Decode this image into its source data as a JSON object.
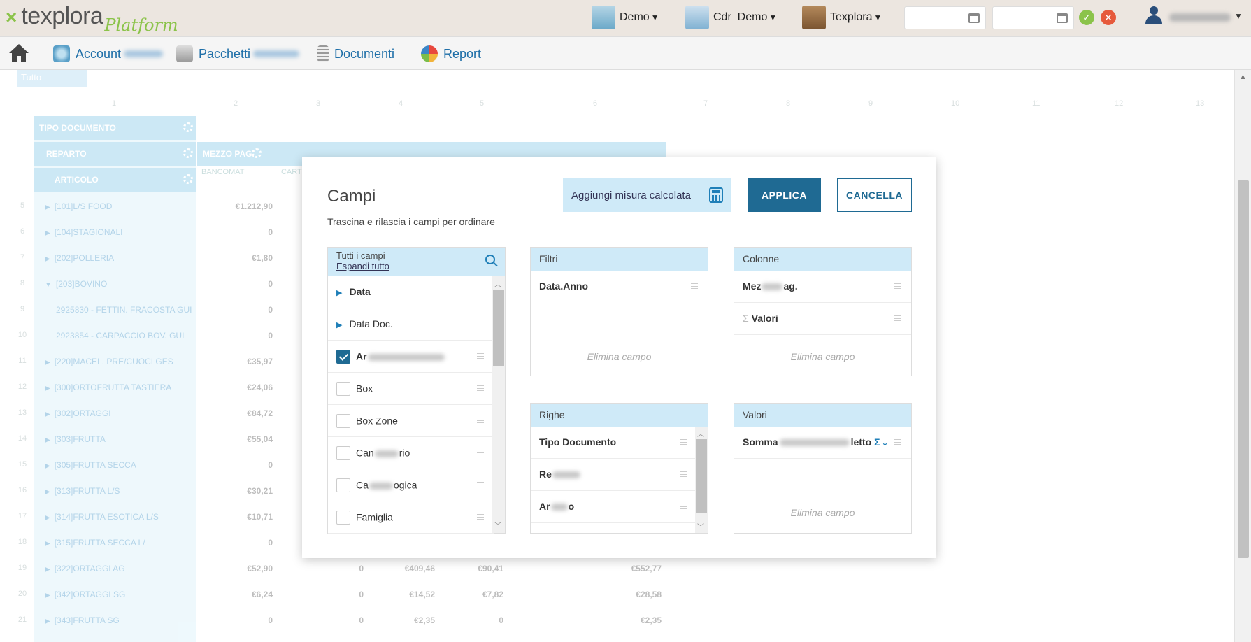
{
  "app": {
    "logo_mark": "×",
    "logo_name": "texplora",
    "logo_sub": "Platform"
  },
  "topbar": {
    "ctx1": "Demo",
    "ctx2": "Cdr_Demo",
    "ctx3": "Texplora",
    "ok_icon": "check-circle-icon",
    "cancel_icon": "x-circle-icon"
  },
  "nav": {
    "account": "Account",
    "pacchetti": "Pacchetti",
    "documenti": "Documenti",
    "report": "Report"
  },
  "background": {
    "tutto": "Tutto",
    "col_numbers": [
      "1",
      "2",
      "3",
      "4",
      "5",
      "6",
      "7",
      "8",
      "9",
      "10",
      "11",
      "12",
      "13"
    ],
    "hdr_tipo": "TIPO DOCUMENTO",
    "hdr_reparto": "REPARTO",
    "hdr_articolo": "ARTICOLO",
    "hdr_mezzo": "MEZZO PAG.",
    "sub1": "BANCOMAT",
    "sub2": "CART",
    "rows": [
      {
        "n": "5",
        "label": "[101]L/S FOOD",
        "v1": "€1.212,90",
        "v2": "",
        "v3": "",
        "v4": "",
        "v5": ""
      },
      {
        "n": "6",
        "label": "[104]STAGIONALI",
        "v1": "0",
        "v2": "",
        "v3": "",
        "v4": "",
        "v5": ""
      },
      {
        "n": "7",
        "label": "[202]POLLERIA",
        "v1": "€1,80",
        "v2": "",
        "v3": "",
        "v4": "",
        "v5": ""
      },
      {
        "n": "8",
        "label": "[203]BOVINO",
        "v1": "0",
        "v2": "",
        "v3": "",
        "v4": "",
        "v5": ""
      },
      {
        "n": "9",
        "label": "2925830 - FETTIN. FRACOSTA GUI",
        "v1": "0",
        "v2": "",
        "v3": "",
        "v4": "",
        "v5": ""
      },
      {
        "n": "10",
        "label": "2923854 - CARPACCIO BOV. GUI",
        "v1": "0",
        "v2": "",
        "v3": "",
        "v4": "",
        "v5": ""
      },
      {
        "n": "11",
        "label": "[220]MACEL. PRE/CUOCI GES",
        "v1": "€35,97",
        "v2": "",
        "v3": "",
        "v4": "",
        "v5": ""
      },
      {
        "n": "12",
        "label": "[300]ORTOFRUTTA TASTIERA",
        "v1": "€24,06",
        "v2": "",
        "v3": "",
        "v4": "",
        "v5": ""
      },
      {
        "n": "13",
        "label": "[302]ORTAGGI",
        "v1": "€84,72",
        "v2": "",
        "v3": "",
        "v4": "",
        "v5": ""
      },
      {
        "n": "14",
        "label": "[303]FRUTTA",
        "v1": "€55,04",
        "v2": "",
        "v3": "",
        "v4": "",
        "v5": ""
      },
      {
        "n": "15",
        "label": "[305]FRUTTA SECCA",
        "v1": "0",
        "v2": "",
        "v3": "",
        "v4": "",
        "v5": ""
      },
      {
        "n": "16",
        "label": "[313]FRUTTA L/S",
        "v1": "€30,21",
        "v2": "",
        "v3": "",
        "v4": "",
        "v5": ""
      },
      {
        "n": "17",
        "label": "[314]FRUTTA ESOTICA L/S",
        "v1": "€10,71",
        "v2": "",
        "v3": "",
        "v4": "",
        "v5": ""
      },
      {
        "n": "18",
        "label": "[315]FRUTTA SECCA L/",
        "v1": "0",
        "v2": "",
        "v3": "",
        "v4": "",
        "v5": ""
      },
      {
        "n": "19",
        "label": "[322]ORTAGGI AG",
        "v1": "€52,90",
        "v2": "0",
        "v3": "€409,46",
        "v4": "€90,41",
        "v5": "€552,77"
      },
      {
        "n": "20",
        "label": "[342]ORTAGGI SG",
        "v1": "€6,24",
        "v2": "0",
        "v3": "€14,52",
        "v4": "€7,82",
        "v5": "€28,58"
      },
      {
        "n": "21",
        "label": "[343]FRUTTA SG",
        "v1": "0",
        "v2": "0",
        "v3": "€2,35",
        "v4": "0",
        "v5": "€2,35"
      }
    ]
  },
  "modal": {
    "title": "Campi",
    "subtitle": "Trascina e rilascia i campi per ordinare",
    "calc_button": "Aggiungi misura calcolata",
    "apply_button": "APPLICA",
    "cancel_button": "CANCELLA",
    "all_fields": {
      "title": "Tutti i campi",
      "expand": "Espandi tutto",
      "items": [
        {
          "label": "Data",
          "type": "expand",
          "bold": true
        },
        {
          "label": "Data Doc.",
          "type": "expand",
          "bold": false
        },
        {
          "label": "Ar",
          "type": "check",
          "checked": true,
          "bold": true
        },
        {
          "label": "Box",
          "type": "check",
          "checked": false
        },
        {
          "label": "Box Zone",
          "type": "check",
          "checked": false
        },
        {
          "label": "Can",
          "suffix": "rio",
          "type": "check",
          "checked": false
        },
        {
          "label": "Ca",
          "suffix": "ogica",
          "type": "check",
          "checked": false
        },
        {
          "label": "Famiglia",
          "type": "check",
          "checked": false
        }
      ]
    },
    "filters": {
      "title": "Filtri",
      "items": [
        "Data.Anno"
      ],
      "drop": "Elimina campo"
    },
    "columns": {
      "title": "Colonne",
      "items": [
        {
          "label": "Mez",
          "suffix": "ag."
        },
        {
          "label": "Valori",
          "sigma": "Σ"
        }
      ],
      "drop": "Elimina campo"
    },
    "rows": {
      "title": "Righe",
      "items": [
        {
          "label": "Tipo Documento"
        },
        {
          "label": "Re",
          "suffix": ""
        },
        {
          "label": "Ar",
          "suffix": "o"
        }
      ]
    },
    "values": {
      "title": "Valori",
      "items": [
        {
          "label": "Somma",
          "suffix": "letto",
          "sigma": "Σ",
          "chevron": "⌄"
        }
      ],
      "drop": "Elimina campo"
    }
  }
}
